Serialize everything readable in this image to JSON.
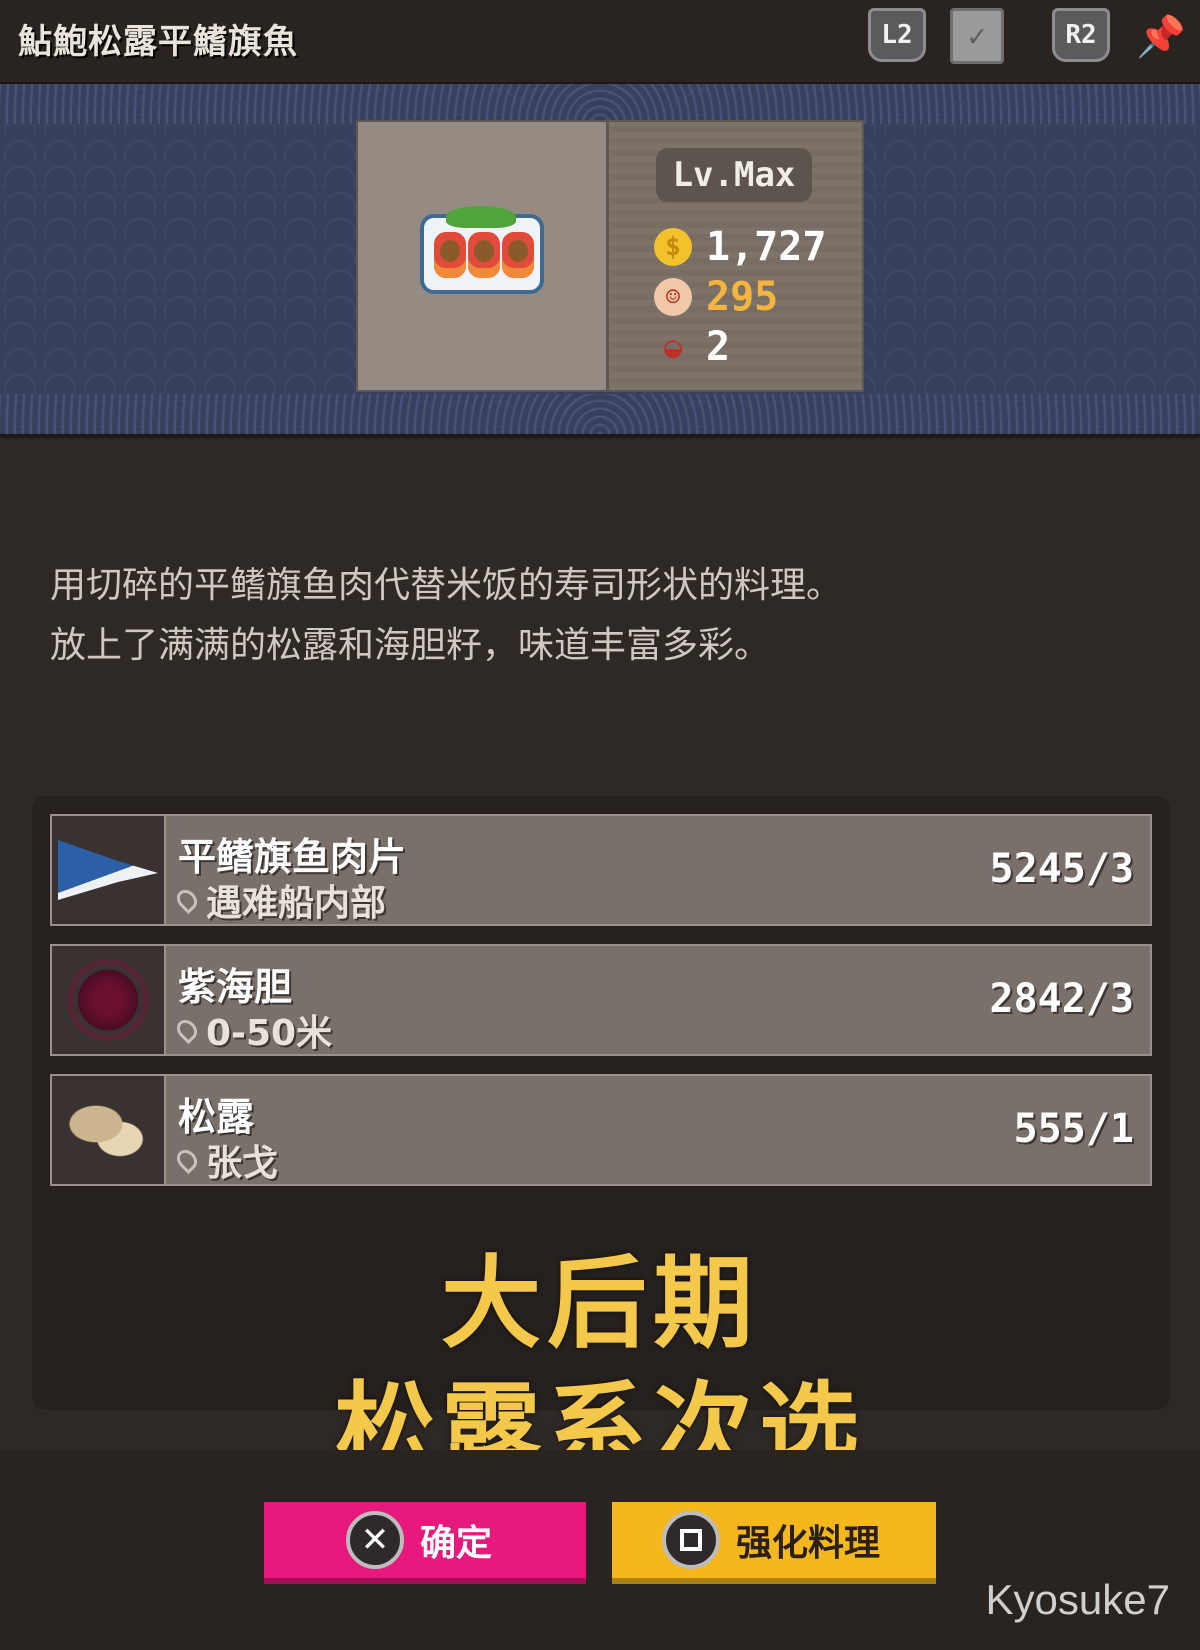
{
  "header": {
    "title": "鮎鮑松露平鰭旗魚",
    "buttons": {
      "l2": "L2",
      "r2": "R2"
    }
  },
  "dish": {
    "level": "Lv.Max",
    "price": "1,727",
    "taste": "295",
    "servings": "2"
  },
  "description": [
    "用切碎的平鳍旗鱼肉代替米饭的寿司形状的料理。",
    "放上了满满的松露和海胆籽，味道丰富多彩。"
  ],
  "ingredients": [
    {
      "name": "平鳍旗鱼肉片",
      "location": "遇难船内部",
      "count": "5245/3",
      "icon": "swordfish-icon"
    },
    {
      "name": "紫海胆",
      "location": "0-50米",
      "count": "2842/3",
      "icon": "sea-urchin-icon"
    },
    {
      "name": "松露",
      "location": "张戈",
      "count": "555/1",
      "icon": "truffle-icon"
    }
  ],
  "overlay_text": [
    "大后期",
    "松露系次选"
  ],
  "actions": {
    "confirm": "确定",
    "enhance": "强化料理"
  },
  "watermark": "Kyosuke7",
  "colors": {
    "confirm_button": "#e8197c",
    "enhance_button": "#f4b81c",
    "taste_value": "#f4b440",
    "overlay_text": "#f4c84a"
  }
}
